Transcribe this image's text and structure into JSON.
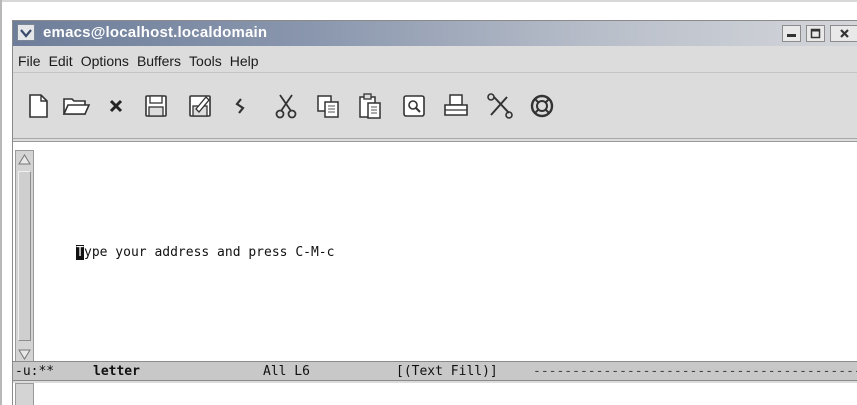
{
  "window": {
    "title": "emacs@localhost.localdomain"
  },
  "menubar": {
    "items": [
      "File",
      "Edit",
      "Options",
      "Buffers",
      "Tools",
      "Help"
    ]
  },
  "toolbar": {
    "buttons": [
      "new-file",
      "open-folder",
      "close",
      "save",
      "save-as",
      "undo",
      "cut",
      "copy",
      "paste",
      "search",
      "print",
      "preferences",
      "help"
    ]
  },
  "editor": {
    "cursor_char": "T",
    "line_rest": "ype your address and press C-M-c"
  },
  "modeline": {
    "flags": "-u:**",
    "buffer": "letter",
    "position": "All L6",
    "mode": "[(Text Fill)]",
    "fill": "--------------------------------------------"
  }
}
